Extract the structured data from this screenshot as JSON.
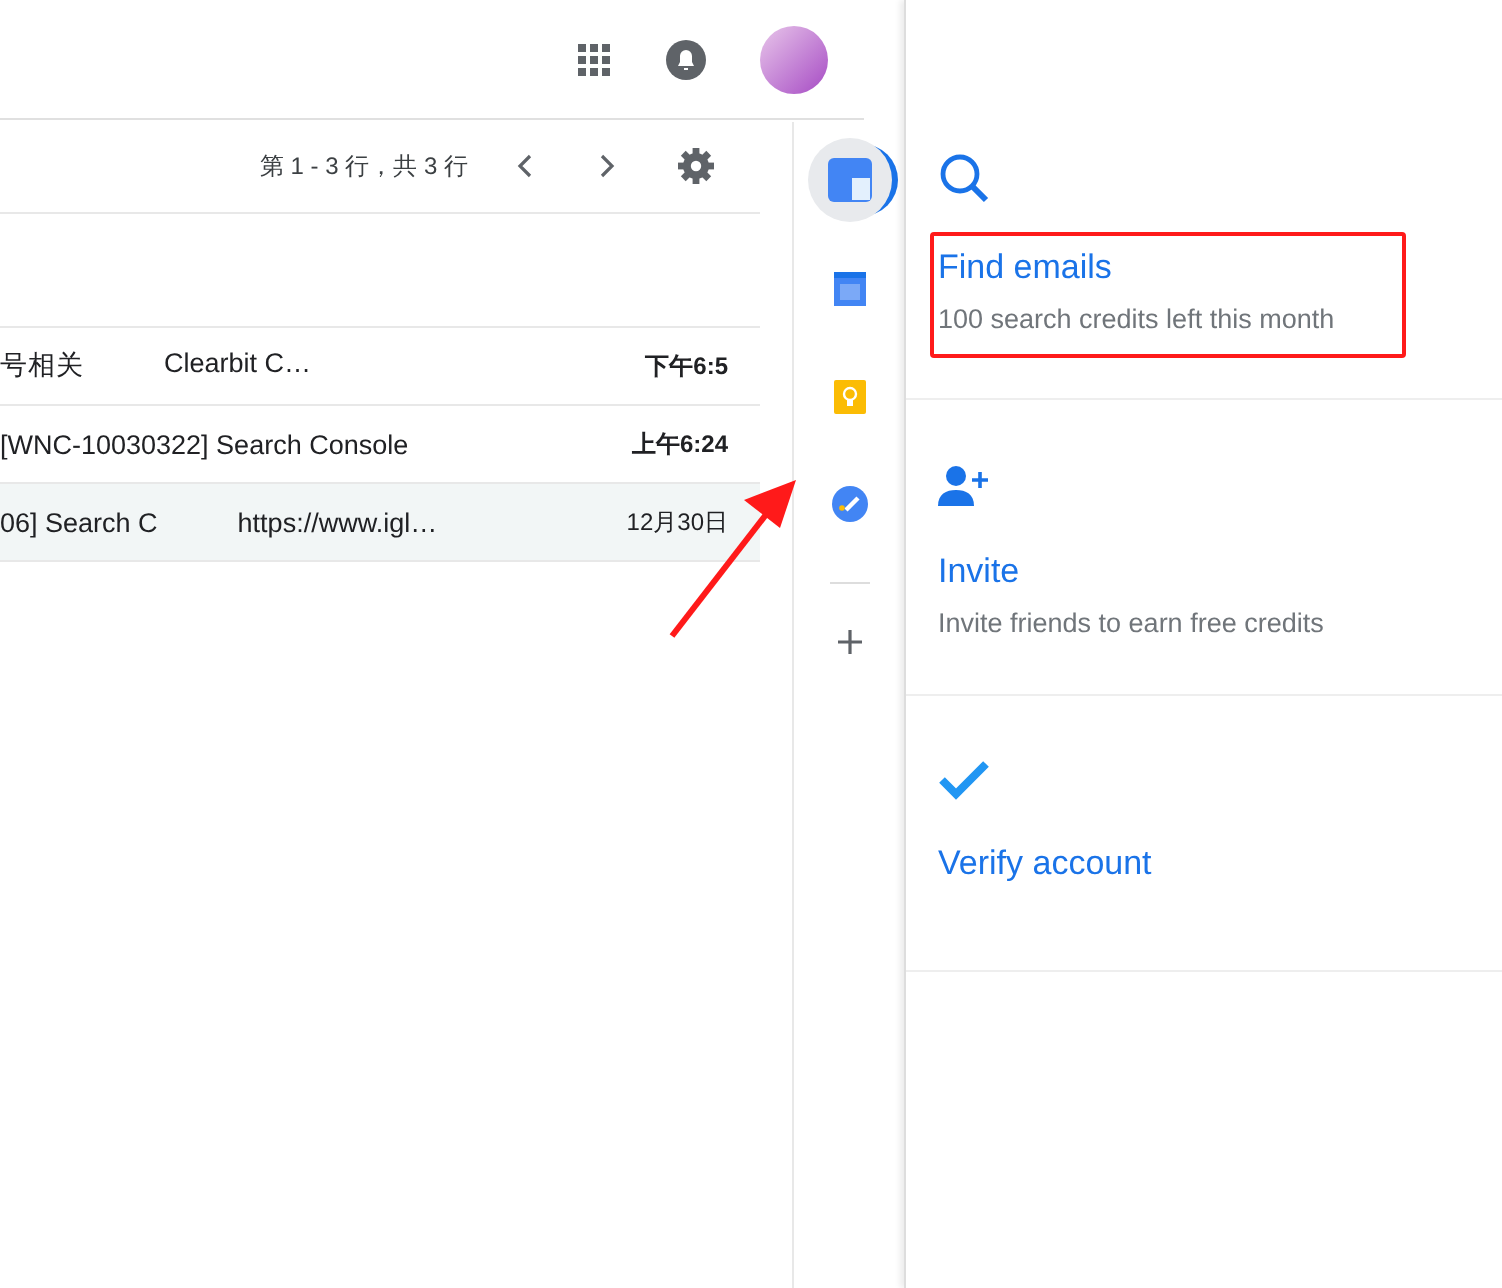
{
  "toolbar": {
    "pagination": "第 1 - 3 行，共 3 行"
  },
  "rows": [
    {
      "parts": [
        "号相关",
        "Clearbit C…"
      ],
      "time": "下午6:5",
      "unread": true,
      "selected": false
    },
    {
      "parts": [
        "[WNC-10030322] Search Console"
      ],
      "time": "上午6:24",
      "unread": true,
      "selected": false
    },
    {
      "parts": [
        "06] Search C",
        "https://www.igl…"
      ],
      "time": "12月30日",
      "unread": false,
      "selected": false
    }
  ],
  "addons": [
    {
      "kind": "app",
      "selected": true
    },
    {
      "kind": "calendar",
      "selected": false
    },
    {
      "kind": "keep",
      "selected": false
    },
    {
      "kind": "tasks",
      "selected": false
    }
  ],
  "panel": [
    {
      "kind": "search",
      "title": "Find emails",
      "subtitle": "100 search credits left this month",
      "highlighted": true
    },
    {
      "kind": "invite",
      "title": "Invite",
      "subtitle": "Invite friends to earn free credits",
      "highlighted": false
    },
    {
      "kind": "verify",
      "title": "Verify account",
      "highlighted": false
    }
  ]
}
